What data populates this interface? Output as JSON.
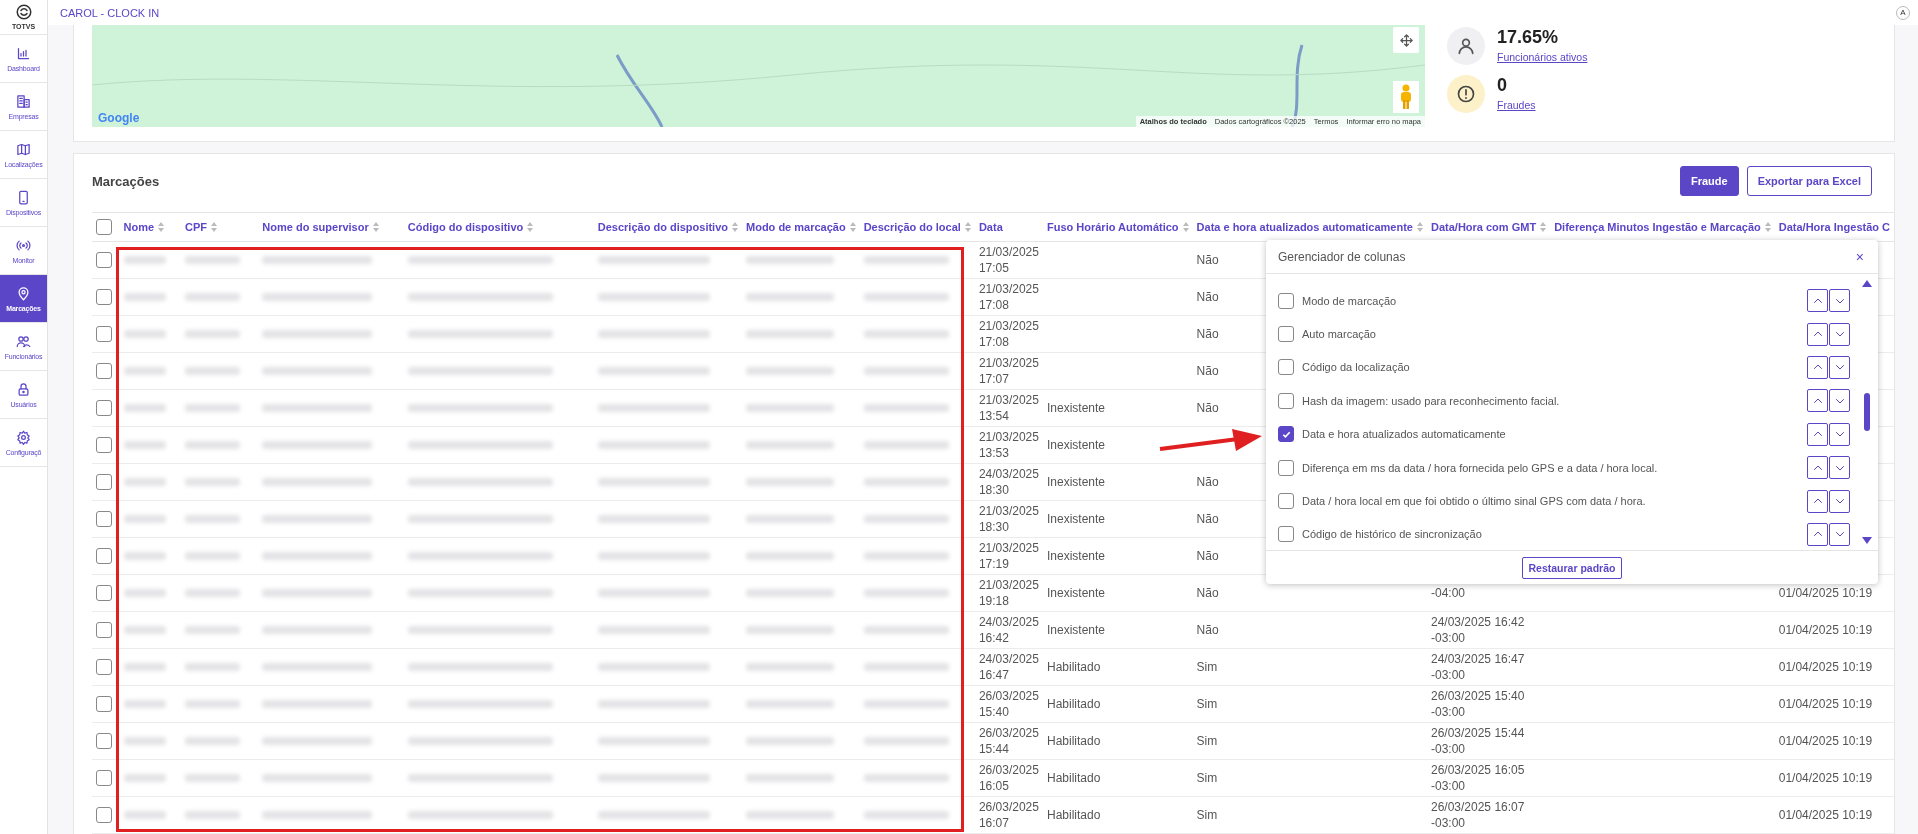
{
  "app": {
    "title": "CAROL - CLOCK IN",
    "avatar": "A"
  },
  "sidebar": {
    "logo": "TOTVS",
    "items": [
      {
        "label": "Dashboard",
        "selected": false
      },
      {
        "label": "Empresas",
        "selected": false
      },
      {
        "label": "Localizações",
        "selected": false
      },
      {
        "label": "Dispositivos",
        "selected": false
      },
      {
        "label": "Monitor",
        "selected": false
      },
      {
        "label": "Marcações",
        "selected": true
      },
      {
        "label": "Funcionários",
        "selected": false
      },
      {
        "label": "Usuários",
        "selected": false
      },
      {
        "label": "Configuraçõ",
        "selected": false
      }
    ]
  },
  "map": {
    "logo": "Google",
    "attribution": [
      "Atalhos do teclado",
      "Dados cartográficos ©2025",
      "Termos",
      "Informar erro no mapa"
    ]
  },
  "stats": [
    {
      "kind": "person",
      "value": "17.65%",
      "label": "Funcionários ativos"
    },
    {
      "kind": "alert",
      "value": "0",
      "label": "Fraudes"
    }
  ],
  "marks": {
    "title": "Marcações",
    "buttons": [
      {
        "kind": "primary",
        "label": "Fraude"
      },
      {
        "kind": "outline",
        "label": "Exportar para Excel"
      }
    ],
    "select_all": {
      "checked": false
    },
    "columns": [
      {
        "label": "Nome",
        "sortable": true,
        "kind": "blurred"
      },
      {
        "label": "CPF",
        "sortable": true,
        "kind": "blurred"
      },
      {
        "label": "Nome do supervisor",
        "sortable": true,
        "kind": "blurred"
      },
      {
        "label": "Código do dispositivo",
        "sortable": true,
        "kind": "blurred"
      },
      {
        "label": "Descrição do dispositivo",
        "sortable": true,
        "kind": "blurred"
      },
      {
        "label": "Modo de marcação",
        "sortable": true,
        "kind": "blurred"
      },
      {
        "label": "Descrição do local",
        "sortable": true,
        "kind": "blurred"
      },
      {
        "label": "Data",
        "sortable": false,
        "kind": "data"
      },
      {
        "label": "Fuso Horário Automático",
        "sortable": true,
        "kind": "fuso"
      },
      {
        "label": "Data e hora atualizados automaticamente",
        "sortable": true,
        "kind": "atualizado"
      },
      {
        "label": "Data/Hora com GMT",
        "sortable": true,
        "kind": "gmt"
      },
      {
        "label": "Diferença Minutos Ingestão e Marcação",
        "sortable": true,
        "kind": "diferenca"
      },
      {
        "label": "Data/Hora Ingestão C",
        "sortable": false,
        "kind": "ingestao"
      }
    ],
    "rows": [
      {
        "checked": false,
        "data": "21/03/2025 17:05",
        "atualizado": "Não"
      },
      {
        "checked": false,
        "data": "21/03/2025 17:08",
        "atualizado": "Não"
      },
      {
        "checked": false,
        "data": "21/03/2025 17:08",
        "atualizado": "Não"
      },
      {
        "checked": false,
        "data": "21/03/2025 17:07",
        "atualizado": "Não"
      },
      {
        "checked": false,
        "data": "21/03/2025 13:54",
        "fuso": "Inexistente",
        "atualizado": "Não"
      },
      {
        "checked": false,
        "data": "21/03/2025 13:53",
        "fuso": "Inexistente"
      },
      {
        "checked": false,
        "data": "24/03/2025 18:30",
        "fuso": "Inexistente",
        "atualizado": "Não"
      },
      {
        "checked": false,
        "data": "21/03/2025 18:30",
        "fuso": "Inexistente",
        "atualizado": "Não"
      },
      {
        "checked": false,
        "data": "21/03/2025 17:19",
        "fuso": "Inexistente",
        "atualizado": "Não"
      },
      {
        "checked": false,
        "data": "21/03/2025 19:18",
        "fuso": "Inexistente",
        "atualizado": "Não",
        "gmt": "-04:00",
        "ingestao": "01/04/2025 10:19"
      },
      {
        "checked": false,
        "data": "24/03/2025 16:42",
        "fuso": "Inexistente",
        "atualizado": "Não",
        "gmt": "24/03/2025 16:42 -03:00",
        "ingestao": "01/04/2025 10:19"
      },
      {
        "checked": false,
        "data": "24/03/2025 16:47",
        "fuso": "Habilitado",
        "atualizado": "Sim",
        "gmt": "24/03/2025 16:47 -03:00",
        "ingestao": "01/04/2025 10:19"
      },
      {
        "checked": false,
        "data": "26/03/2025 15:40",
        "fuso": "Habilitado",
        "atualizado": "Sim",
        "gmt": "26/03/2025 15:40 -03:00",
        "ingestao": "01/04/2025 10:19"
      },
      {
        "checked": false,
        "data": "26/03/2025 15:44",
        "fuso": "Habilitado",
        "atualizado": "Sim",
        "gmt": "26/03/2025 15:44 -03:00",
        "ingestao": "01/04/2025 10:19"
      },
      {
        "checked": false,
        "data": "26/03/2025 16:05",
        "fuso": "Habilitado",
        "atualizado": "Sim",
        "gmt": "26/03/2025 16:05 -03:00",
        "ingestao": "01/04/2025 10:19"
      },
      {
        "checked": false,
        "data": "26/03/2025 16:07",
        "fuso": "Habilitado",
        "atualizado": "Sim",
        "gmt": "26/03/2025 16:07 -03:00",
        "ingestao": "01/04/2025 10:19"
      }
    ]
  },
  "column_manager": {
    "title": "Gerenciador de colunas",
    "close": "×",
    "restore": "Restaurar padrão",
    "items": [
      {
        "label": "Modo de marcação",
        "checked": false
      },
      {
        "label": "Auto marcação",
        "checked": false
      },
      {
        "label": "Código da localização",
        "checked": false
      },
      {
        "label": "Hash da imagem: usado para reconhecimento facial.",
        "checked": false
      },
      {
        "label": "Data e hora atualizados automaticamente",
        "checked": true
      },
      {
        "label": "Diferença em ms da data / hora fornecida pelo GPS e a data / hora local.",
        "checked": false
      },
      {
        "label": "Data / hora local em que foi obtido o último sinal GPS com data / hora.",
        "checked": false
      },
      {
        "label": "Código de histórico de sincronização",
        "checked": false
      }
    ]
  }
}
